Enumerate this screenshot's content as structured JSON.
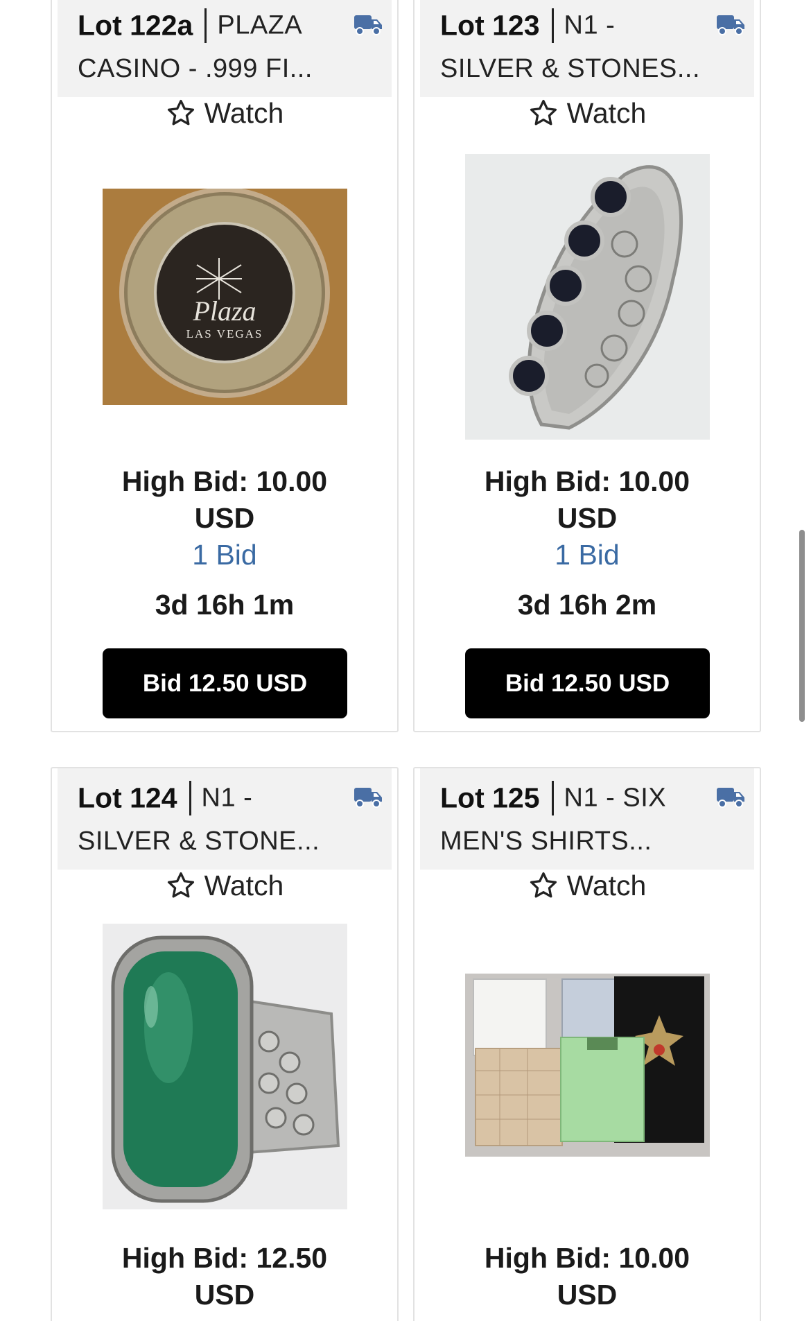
{
  "lots": [
    {
      "lot_number": "Lot 122a",
      "title_line1": "PLAZA",
      "title_line2": "CASINO - .999 FI...",
      "watch_label": "Watch",
      "high_bid": "High Bid: 10.00",
      "currency": "USD",
      "bid_count": "1 Bid",
      "time_left": "3d 16h 1m",
      "bid_button": "Bid 12.50 USD",
      "image_label": "Plaza Las Vegas silver gaming token"
    },
    {
      "lot_number": "Lot 123",
      "title_line1": "N1 -",
      "title_line2": "SILVER & STONES...",
      "watch_label": "Watch",
      "high_bid": "High Bid: 10.00",
      "currency": "USD",
      "bid_count": "1 Bid",
      "time_left": "3d 16h 2m",
      "bid_button": "Bid 12.50 USD",
      "image_label": "Silver ring with black stones"
    },
    {
      "lot_number": "Lot 124",
      "title_line1": "N1 -",
      "title_line2": "SILVER & STONE...",
      "watch_label": "Watch",
      "high_bid": "High Bid: 12.50",
      "currency": "USD",
      "bid_count": "",
      "image_label": "Silver ring with green stone"
    },
    {
      "lot_number": "Lot 125",
      "title_line1": "N1 - SIX",
      "title_line2": "MEN'S SHIRTS...",
      "watch_label": "Watch",
      "high_bid": "High Bid: 10.00",
      "currency": "USD",
      "bid_count": "",
      "image_label": "Six men's shirts"
    }
  ],
  "colors": {
    "accent_link": "#3a6aa3",
    "truck_icon": "#4a6fa5",
    "button_bg": "#000000",
    "header_bg": "#f2f2f2"
  },
  "icons": {
    "shipping": "truck-icon",
    "watch": "star-outline-icon"
  }
}
